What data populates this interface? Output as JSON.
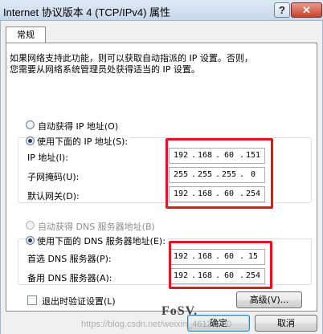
{
  "window": {
    "title": "Internet 协议版本 4 (TCP/IPv4) 属性",
    "help_label": "?",
    "close_label": "✕"
  },
  "tab": {
    "label": "常规"
  },
  "description": {
    "line1": "如果网络支持此功能，则可以获取自动指派的 IP 设置。否则，",
    "line2": "您需要从网络系统管理员处获得适当的 IP 设置。"
  },
  "ip": {
    "auto_label": "自动获得 IP 地址(O)",
    "auto_selected": false,
    "manual_label": "使用下面的 IP 地址(S):",
    "manual_selected": true,
    "address_label": "IP 地址(I):",
    "address": [
      "192",
      "168",
      "60",
      "151"
    ],
    "subnet_label": "子网掩码(U):",
    "subnet": [
      "255",
      "255",
      "255",
      "0"
    ],
    "gateway_label": "默认网关(D):",
    "gateway": [
      "192",
      "168",
      "60",
      "254"
    ]
  },
  "dns": {
    "auto_label": "自动获得 DNS 服务器地址(B)",
    "auto_selected": false,
    "auto_disabled": true,
    "manual_label": "使用下面的 DNS 服务器地址(E):",
    "manual_selected": true,
    "preferred_label": "首选 DNS 服务器(P):",
    "preferred": [
      "192",
      "168",
      "60",
      "15"
    ],
    "alternate_label": "备用 DNS 服务器(A):",
    "alternate": [
      "192",
      "168",
      "60",
      "254"
    ]
  },
  "validate_on_exit": {
    "label": "退出时验证设置(L)",
    "checked": false
  },
  "buttons": {
    "advanced_label": "高级(V)...",
    "ok_label": "确定",
    "cancel_label": "取消"
  },
  "watermark": {
    "text": "https://blog.csdn.net/weixin_46129820",
    "stamp_text": "FoSV."
  },
  "colors": {
    "highlight_box": "#e8141c",
    "titlebar": "#c7d7ea",
    "dialog_bg": "#f0f0f0"
  }
}
